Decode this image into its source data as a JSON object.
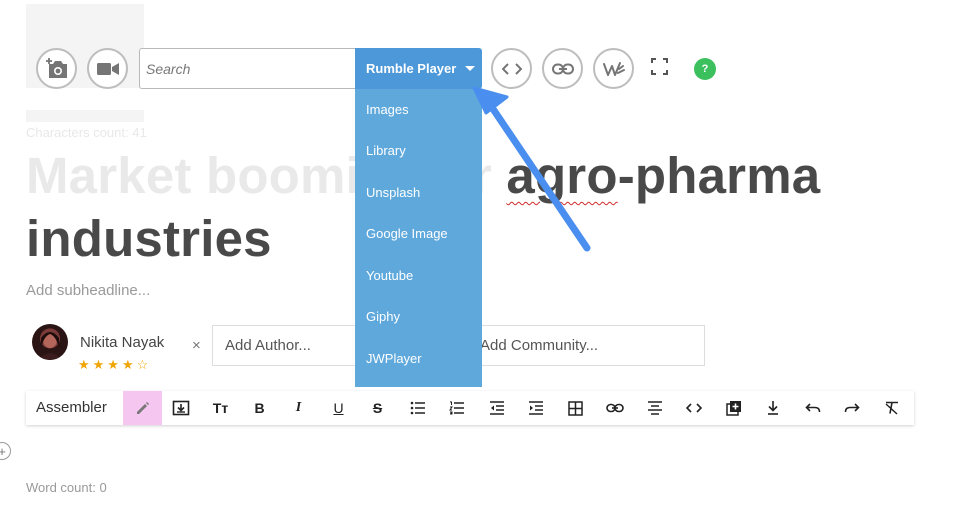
{
  "media_bar": {
    "search_placeholder": "Search",
    "player_label": "Rumble Player",
    "help_label": "?",
    "icons": [
      "add-photo-icon",
      "video-icon",
      "code-icon",
      "link-icon",
      "jwplayer-icon",
      "fullscreen-icon",
      "help-icon"
    ]
  },
  "dropdown": {
    "items": [
      "Images",
      "Library",
      "Unsplash",
      "Google Image",
      "Youtube",
      "Giphy",
      "JWPlayer"
    ]
  },
  "article": {
    "char_count": "Characters count: 41",
    "headline_line1_a": "Market boomi",
    "headline_line1_b": "r ",
    "headline_line1_c": "agro",
    "headline_line1_d": "-pharma",
    "headline_line2": "industries",
    "subheadline": "Add subheadline..."
  },
  "author": {
    "name": "Nikita Nayak",
    "stars": "★★★★☆",
    "remove": "×",
    "author_placeholder": "Add Author...",
    "community_placeholder": "Add Community..."
  },
  "toolbar": {
    "label": "Assembler",
    "heading_glyph": "Tт",
    "bold_glyph": "B",
    "italic_glyph": "I",
    "underline_glyph": "U",
    "strike_glyph": "S"
  },
  "editor": {
    "side_plus": "+",
    "word_count": "Word count: 0"
  },
  "colors": {
    "accent": "#4d98d8",
    "dropdown_bg": "#5ea8dc",
    "help_green": "#3cc05e",
    "active_tool": "#f4c6f0",
    "annotation_arrow": "#4a8fef",
    "star": "#f0a500"
  }
}
